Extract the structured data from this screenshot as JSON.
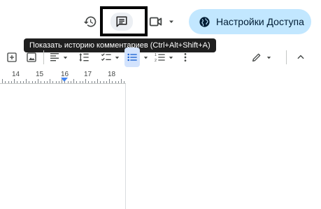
{
  "header": {
    "history_icon": "history-icon",
    "comments_icon": "comments-icon",
    "meet_icon": "video-camera-icon",
    "share": {
      "icon": "globe-icon",
      "label": "Настройки Доступа",
      "color": "#c2e7ff"
    }
  },
  "tooltip": {
    "text": "Показать историю комментариев (Ctrl+Alt+Shift+A)"
  },
  "toolbar": {
    "icons": [
      "add-comment-icon",
      "insert-image-icon",
      "align-left-icon",
      "line-spacing-icon",
      "checklist-icon",
      "bulleted-list-icon",
      "numbered-list-icon",
      "more-options-icon",
      "edit-mode-icon",
      "collapse-icon"
    ]
  },
  "ruler": {
    "numbers": [
      "14",
      "15",
      "16",
      "17",
      "18"
    ]
  },
  "colors": {
    "accent": "#c2e7ff",
    "active_list": "#d3e3fd",
    "ruler_marker": "#4285f4"
  }
}
